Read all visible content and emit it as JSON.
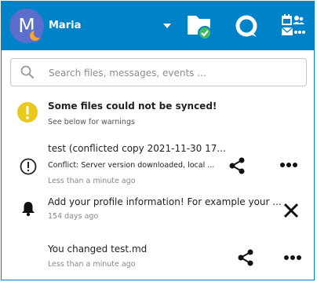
{
  "user": {
    "initial": "M",
    "name": "Maria"
  },
  "header": {
    "icons": [
      "files-icon",
      "talk-icon",
      "apps-icon"
    ],
    "colors": {
      "background": "#0082c9",
      "avatar": "#5b6ecb",
      "status": "#f4a331",
      "sync_ok": "#46ba61"
    }
  },
  "search": {
    "value": "",
    "placeholder": "Search files, messages, events ..."
  },
  "notice": {
    "title": "Some files could not be synced!",
    "subtitle": "See below for warnings",
    "icon": "warning-icon",
    "color": "#e9c91e"
  },
  "activities": [
    {
      "icon": "info-icon",
      "title": "test (conflicted copy 2021-11-30 17...",
      "detail": "Conflict: Server version downloaded, local ...",
      "time": "Less than a minute ago",
      "action": "share-icon",
      "more": "more-icon"
    },
    {
      "icon": "bell-icon",
      "title": "Add your profile information! For example your ...",
      "time": "154 days ago",
      "action": "close-icon"
    },
    {
      "icon": "",
      "title": "You changed test.md",
      "time": "Less than a minute ago",
      "action": "share-icon",
      "more": "more-icon"
    }
  ]
}
